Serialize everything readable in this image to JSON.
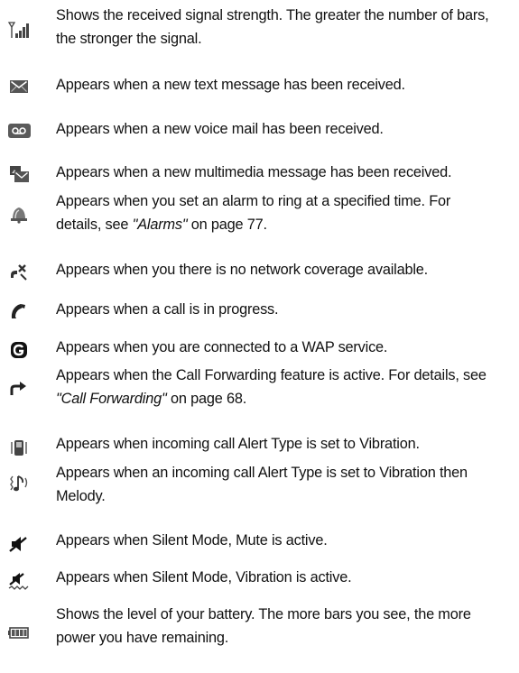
{
  "icons": [
    {
      "icon": "signal-strength-icon",
      "text": "Shows the received signal strength. The greater the number of bars, the stronger the signal."
    },
    {
      "icon": "text-message-icon",
      "text": "Appears when a new text message has been received."
    },
    {
      "icon": "voicemail-icon",
      "text": "Appears when a new voice mail has been received."
    },
    {
      "icon": "multimedia-message-icon",
      "text": "Appears when a new multimedia message has been received."
    },
    {
      "icon": "alarm-icon",
      "text_before": "Appears when you set an alarm to ring at a specified time. For details, see ",
      "link": "\"Alarms\"",
      "text_after": " on page 77."
    },
    {
      "icon": "no-network-icon",
      "text": "Appears when you there is no network coverage available."
    },
    {
      "icon": "call-in-progress-icon",
      "text": "Appears when a call is in progress."
    },
    {
      "icon": "wap-connected-icon",
      "text": "Appears when you are connected to a WAP service."
    },
    {
      "icon": "call-forwarding-icon",
      "text_before": "Appears when the Call Forwarding feature is active. For details, see ",
      "link": "\"Call Forwarding\"",
      "text_after": " on page 68."
    },
    {
      "icon": "vibration-icon",
      "text": "Appears when incoming call Alert Type is set to Vibration."
    },
    {
      "icon": "vibration-then-melody-icon",
      "text": "Appears when an incoming call Alert Type is set to Vibration then Melody."
    },
    {
      "icon": "silent-mute-icon",
      "text": "Appears when Silent Mode, Mute is active."
    },
    {
      "icon": "silent-vibration-icon",
      "text": "Appears when Silent Mode, Vibration is active."
    },
    {
      "icon": "battery-icon",
      "text": "Shows the level of your battery. The more bars you see, the more power you have remaining."
    }
  ]
}
